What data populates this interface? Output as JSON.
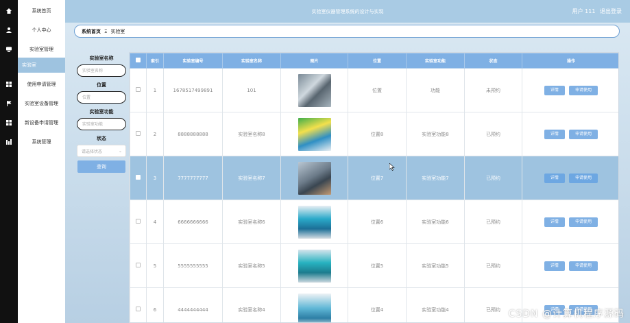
{
  "header": {
    "title": "实验室仪器管理系统的设计与实现",
    "user": "用户 111",
    "logout": "退出登录"
  },
  "rail_icons": [
    "home-icon",
    "user-icon",
    "lab-icon",
    "apps-icon",
    "flag-icon",
    "grid-icon",
    "chart-icon"
  ],
  "menu": {
    "items": [
      {
        "label": "系统首页"
      },
      {
        "label": "个人中心"
      },
      {
        "label": "实验室管理"
      },
      {
        "label": "实验室"
      },
      {
        "label": "使用申请管理"
      },
      {
        "label": "实验室设备管理"
      },
      {
        "label": "新设备申请管理"
      },
      {
        "label": "系统管理"
      }
    ]
  },
  "breadcrumb": {
    "home": "系统首页",
    "sep": "Ξ",
    "current": "实验室"
  },
  "search": {
    "name_label": "实验室名称",
    "name_placeholder": "实验室名称",
    "location_label": "位置",
    "location_placeholder": "位置",
    "function_label": "实验室功能",
    "function_placeholder": "实验室功能",
    "status_label": "状态",
    "status_placeholder": "请选择状态",
    "button": "查询"
  },
  "table": {
    "columns": [
      "索引",
      "实验室编号",
      "实验室名称",
      "图片",
      "位置",
      "实验室功能",
      "状态",
      "操作"
    ],
    "rows": [
      {
        "index": "1",
        "code": "1678517499891",
        "name": "101",
        "location": "位置",
        "function": "功能",
        "status": "未预约",
        "selected": false,
        "img": "lab-photo-1"
      },
      {
        "index": "2",
        "code": "8888888888",
        "name": "实验室名称8",
        "location": "位置8",
        "function": "实验室功能8",
        "status": "已预约",
        "selected": false,
        "img": "lab-photo-2"
      },
      {
        "index": "3",
        "code": "7777777777",
        "name": "实验室名称7",
        "location": "位置7",
        "function": "实验室功能7",
        "status": "已预约",
        "selected": true,
        "img": "lab-photo-3"
      },
      {
        "index": "4",
        "code": "6666666666",
        "name": "实验室名称6",
        "location": "位置6",
        "function": "实验室功能6",
        "status": "已预约",
        "selected": false,
        "img": "lab-photo-4"
      },
      {
        "index": "5",
        "code": "5555555555",
        "name": "实验室名称5",
        "location": "位置5",
        "function": "实验室功能5",
        "status": "已预约",
        "selected": false,
        "img": "lab-photo-5"
      },
      {
        "index": "6",
        "code": "4444444444",
        "name": "实验室名称4",
        "location": "位置4",
        "function": "实验室功能4",
        "status": "已预约",
        "selected": false,
        "img": "lab-photo-6"
      }
    ],
    "detail_label": "详情",
    "apply_label": "申请使用"
  },
  "watermark": "CSDN @计算机程序源码",
  "colors": {
    "accent": "#7fb0e4",
    "header": "#a9cbe4",
    "selected_row": "#9ec3e0",
    "rail": "#111111"
  }
}
